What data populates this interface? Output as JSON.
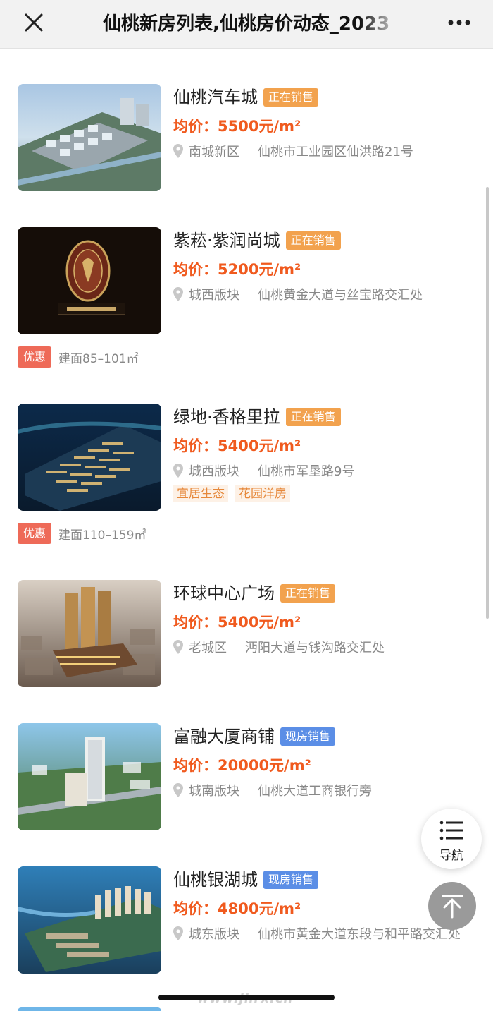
{
  "header": {
    "title": "仙桃新房列表,仙桃房价动态_2023",
    "close_icon": "close-icon",
    "more_icon": "more-horizontal-icon"
  },
  "colors": {
    "on_sale": "#f2a24e",
    "ready_sale": "#5b8ee6",
    "price": "#f05a1e",
    "promo": "#ee6a58"
  },
  "listings": [
    {
      "name": "仙桃汽车城",
      "status": "正在销售",
      "status_type": "on_sale",
      "price": "均价：5500元/m²",
      "district": "南城新区",
      "address": "仙桃市工业园区仙洪路21号"
    },
    {
      "name": "紫菘·紫润尚城",
      "status": "正在销售",
      "status_type": "on_sale",
      "price": "均价：5200元/m²",
      "district": "城西版块",
      "address": "仙桃黄金大道与丝宝路交汇处",
      "promo_badge": "优惠",
      "promo_text": "建面85–101㎡"
    },
    {
      "name": "绿地·香格里拉",
      "status": "正在销售",
      "status_type": "on_sale",
      "price": "均价：5400元/m²",
      "district": "城西版块",
      "address": "仙桃市军垦路9号",
      "tags": [
        "宜居生态",
        "花园洋房"
      ],
      "promo_badge": "优惠",
      "promo_text": "建面110–159㎡"
    },
    {
      "name": "环球中心广场",
      "status": "正在销售",
      "status_type": "on_sale",
      "price": "均价：5400元/m²",
      "district": "老城区",
      "address": "沔阳大道与钱沟路交汇处"
    },
    {
      "name": "富融大厦商铺",
      "status": "现房销售",
      "status_type": "ready_sale",
      "price": "均价：20000元/m²",
      "district": "城南版块",
      "address": "仙桃大道工商银行旁"
    },
    {
      "name": "仙桃银湖城",
      "status": "现房销售",
      "status_type": "ready_sale",
      "price": "均价：4800元/m²",
      "district": "城东版块",
      "address": "仙桃市黄金大道东段与和平路交汇处"
    }
  ],
  "floating": {
    "nav_label": "导航",
    "nav_icon": "menu-list-icon",
    "top_icon": "back-to-top-icon"
  },
  "watermark": "www.jhrx.cn"
}
